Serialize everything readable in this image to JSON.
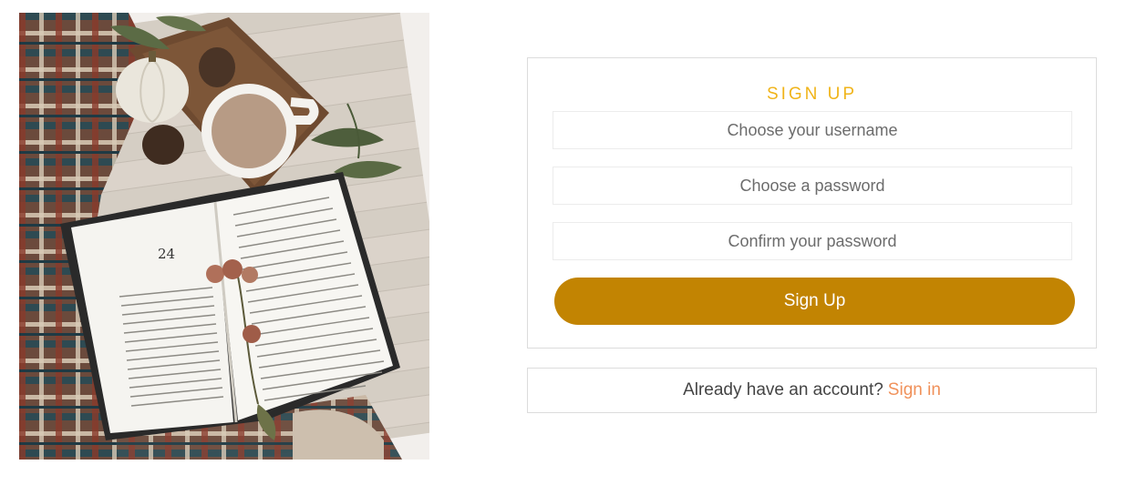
{
  "hero": {
    "page_number": "24"
  },
  "signup": {
    "title": "SIGN UP",
    "username_placeholder": "Choose your username",
    "password_placeholder": "Choose a password",
    "confirm_placeholder": "Confirm your password",
    "button_label": "Sign Up"
  },
  "signin": {
    "prompt": "Already have an account?",
    "link_label": "Sign in"
  },
  "colors": {
    "title": "#f0b41a",
    "button": "#c28402",
    "link": "#f0915a",
    "border": "#dcdcdc"
  }
}
